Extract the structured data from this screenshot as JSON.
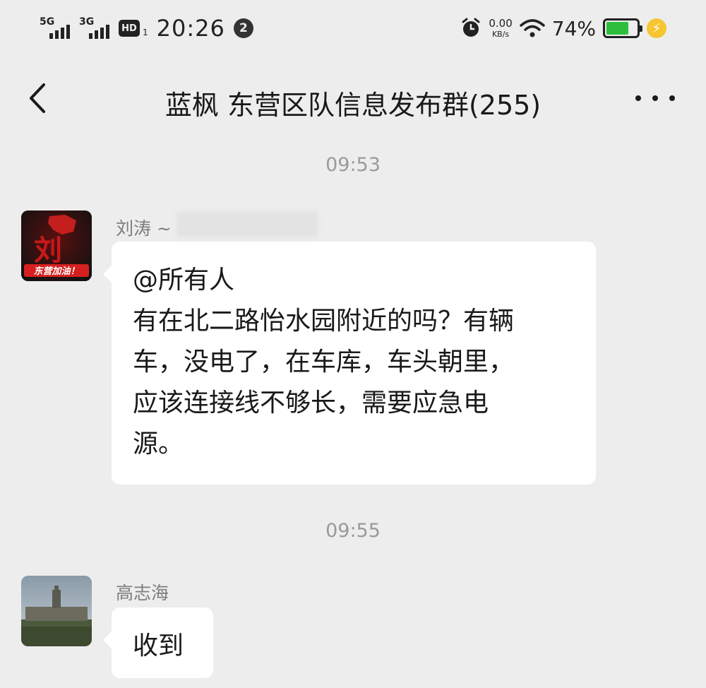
{
  "status_bar": {
    "network_1": "5G",
    "network_2": "3G",
    "hd_label": "HD",
    "hd_sub": "1",
    "time": "20:26",
    "notification_count": "2",
    "net_speed_value": "0.00",
    "net_speed_unit": "KB/s",
    "battery_percent": "74%",
    "battery_level": 0.74,
    "battery_color": "#2dbf3c"
  },
  "header": {
    "title": "蓝枫 东营区队信息发布群(255)",
    "back_icon": "chevron-left-icon",
    "more_icon": "more-dots-icon"
  },
  "messages": [
    {
      "timestamp": "09:53",
      "sender": "刘涛 ~",
      "avatar_text": "东营加油！",
      "avatar_glyph": "刘",
      "lines": [
        "@所有人",
        "有在北二路怡水园附近的吗？有辆",
        "车，没电了，在车库，车头朝里，",
        "应该连接线不够长，需要应急电",
        "源。"
      ]
    },
    {
      "timestamp": "09:55",
      "sender": "高志海",
      "lines": [
        "收到"
      ]
    }
  ],
  "colors": {
    "background": "#ededed",
    "bubble": "#ffffff",
    "timestamp_text": "#9a9a9a",
    "sender_text": "#7d7d7d"
  }
}
